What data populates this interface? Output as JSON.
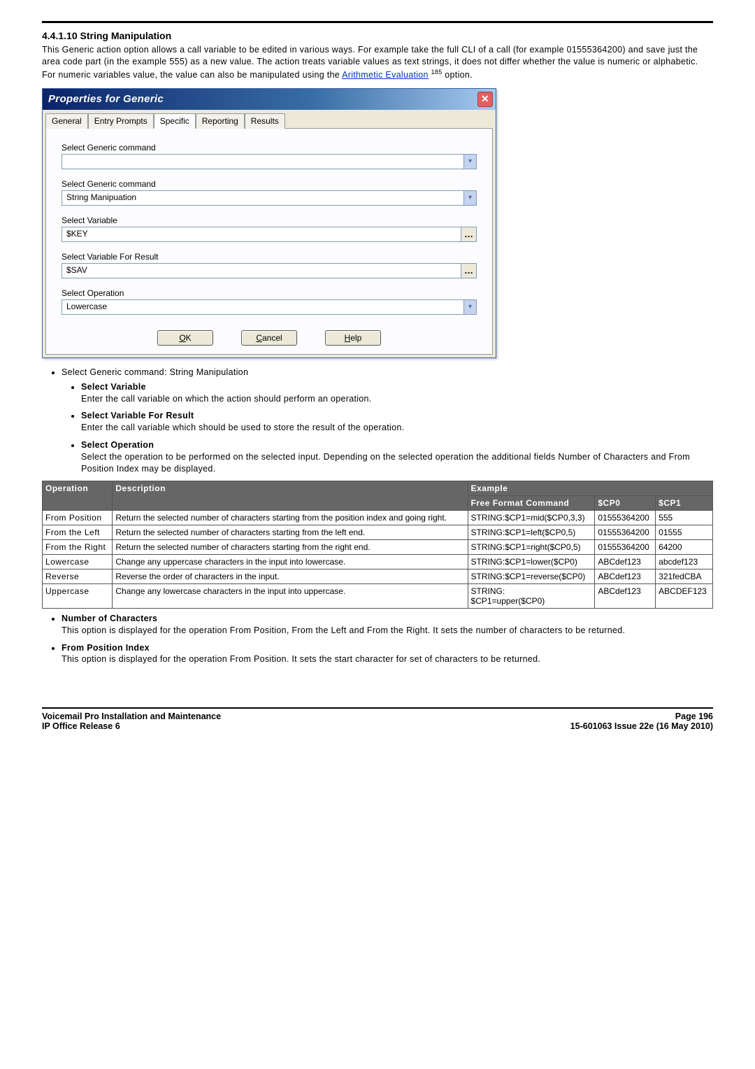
{
  "heading": "4.4.1.10 String Manipulation",
  "intro": {
    "part1": "This Generic action option allows a call variable to be edited in various ways. For example take the full CLI of a call (for example 01555364200) and save just the area code part (in the example 555) as a new value. The action treats variable values as text strings, it does not differ whether the value is numeric or alphabetic. For numeric variables value, the value can also be manipulated using the ",
    "link_text": "Arithmetic Evaluation",
    "page_ref": "185",
    "part2": " option."
  },
  "dialog": {
    "title": "Properties for Generic",
    "tabs": [
      "General",
      "Entry Prompts",
      "Specific",
      "Reporting",
      "Results"
    ],
    "active_tab_index": 2,
    "fields": {
      "generic_cmd_label": "Select Generic command",
      "generic_cmd_value": "",
      "generic_cmd2_label": "Select Generic command",
      "generic_cmd2_value": "String Manipuation",
      "select_var_label": "Select Variable",
      "select_var_value": "$KEY",
      "select_var_result_label": "Select Variable For Result",
      "select_var_result_value": "$SAV",
      "select_op_label": "Select Operation",
      "select_op_value": "Lowercase"
    },
    "buttons": {
      "ok": "OK",
      "cancel": "Cancel",
      "help": "Help"
    }
  },
  "doc_list": {
    "l0": "Select Generic command: String Manipulation",
    "sv_title": "Select Variable",
    "sv_text": "Enter the call variable on which the action should perform an operation.",
    "svr_title": "Select Variable For Result",
    "svr_text": "Enter the call variable which should be used to store the result of the operation.",
    "so_title": "Select Operation",
    "so_text": "Select the operation to be performed on the selected input. Depending on the selected operation the additional fields Number of Characters and From Position Index may be displayed."
  },
  "table": {
    "headers": {
      "operation": "Operation",
      "description": "Description",
      "example": "Example",
      "ffc": "Free Format Command",
      "cp0": "$CP0",
      "cp1": "$CP1"
    },
    "rows": [
      {
        "op": "From Position",
        "desc": "Return the selected number of characters starting from the position index and going right.",
        "cmd": "STRING:$CP1=mid($CP0,3,3)",
        "cp0": "01555364200",
        "cp1": "555"
      },
      {
        "op": "From the Left",
        "desc": "Return the selected number of characters starting from the left end.",
        "cmd": "STRING:$CP1=left($CP0,5)",
        "cp0": "01555364200",
        "cp1": "01555"
      },
      {
        "op": "From the Right",
        "desc": "Return the selected number of characters starting from the right end.",
        "cmd": "STRING:$CP1=right($CP0,5)",
        "cp0": "01555364200",
        "cp1": "64200"
      },
      {
        "op": "Lowercase",
        "desc": "Change any uppercase characters in the input into lowercase.",
        "cmd": "STRING:$CP1=lower($CP0)",
        "cp0": "ABCdef123",
        "cp1": "abcdef123"
      },
      {
        "op": "Reverse",
        "desc": "Reverse the order of characters in the input.",
        "cmd": "STRING:$CP1=reverse($CP0)",
        "cp0": "ABCdef123",
        "cp1": "321fedCBA"
      },
      {
        "op": "Uppercase",
        "desc": "Change any lowercase characters in the input into uppercase.",
        "cmd": "STRING:\n$CP1=upper($CP0)",
        "cp0": "ABCdef123",
        "cp1": "ABCDEF123"
      }
    ]
  },
  "post_list": {
    "noc_title": "Number of Characters",
    "noc_text": "This option is displayed for the operation From Position, From the Left and From the Right. It sets the number of characters to be returned.",
    "fpi_title": "From Position Index",
    "fpi_text": "This option is displayed for the operation From Position. It sets the start character for set of characters to be returned."
  },
  "footer": {
    "left1": "Voicemail Pro Installation and Maintenance",
    "left2": "IP Office Release 6",
    "right1": "Page 196",
    "right2": "15-601063 Issue 22e (16 May 2010)"
  }
}
